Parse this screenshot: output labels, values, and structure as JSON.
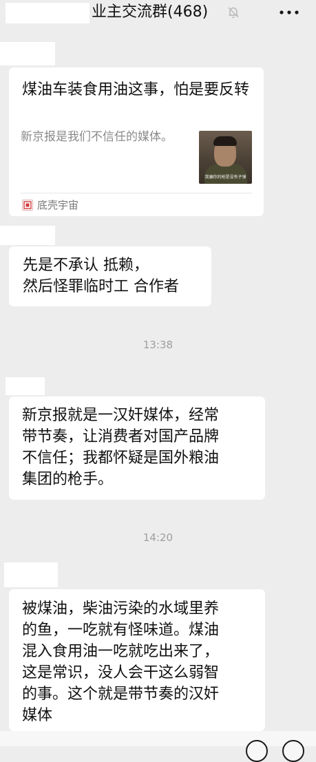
{
  "header": {
    "group_title": "业主交流群(468)",
    "mute_icon": "bell-off-icon",
    "more_icon": "more-dots-icon"
  },
  "messages": [
    {
      "type": "link_card",
      "title": "煤油车装食用油这事，怕是要反转",
      "description": "新京报是我们不信任的媒体。",
      "thumbnail_caption": "我骗你的枪是没有子弹",
      "source_name": "底壳宇宙",
      "source_icon": "app-logo-icon"
    },
    {
      "type": "text",
      "text": "先是不承认 抵赖，\n然后怪罪临时工 合作者"
    },
    {
      "type": "time",
      "text": "13:38"
    },
    {
      "type": "text",
      "text": "新京报就是一汉奸媒体，经常\n带节奏，让消费者对国产品牌\n不信任；我都怀疑是国外粮油\n集团的枪手。"
    },
    {
      "type": "time",
      "text": "14:20"
    },
    {
      "type": "text",
      "text": "被煤油，柴油污染的水域里养\n的鱼，一吃就有怪味道。煤油\n混入食用油一吃就吃出来了，\n这是常识，没人会干这么弱智\n的事。这个就是带节奏的汉奸\n媒体"
    }
  ],
  "colors": {
    "background": "#ededed",
    "bubble": "#ffffff",
    "time_text": "#9e9e9e",
    "secondary_text": "#8a8a8a"
  }
}
